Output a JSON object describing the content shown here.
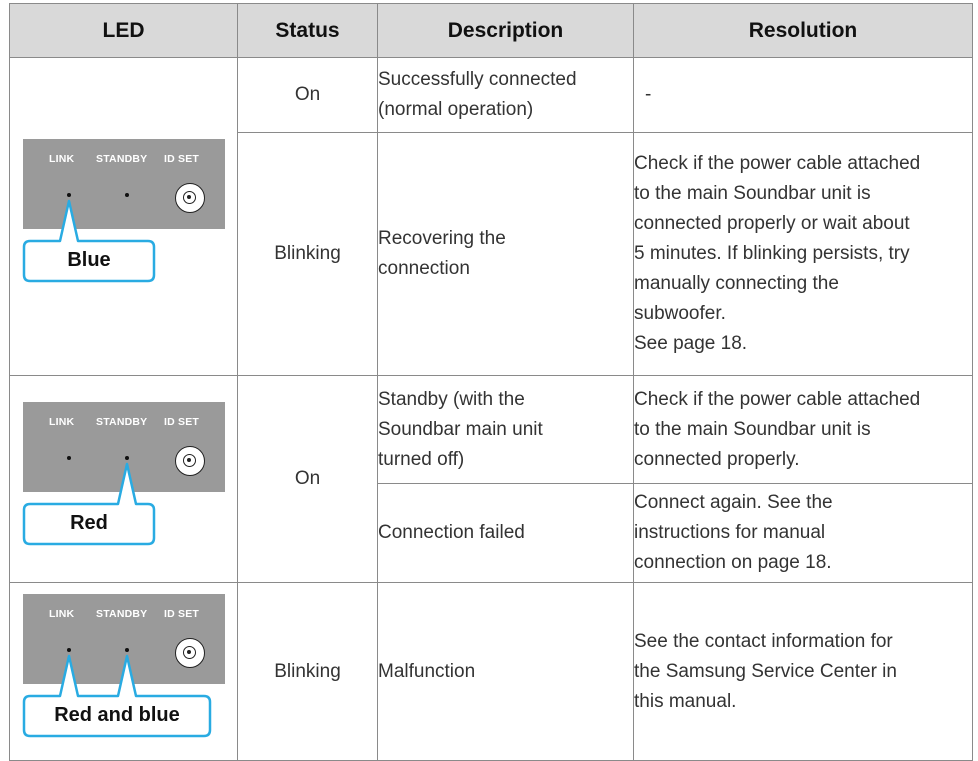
{
  "headers": {
    "led": "LED",
    "status": "Status",
    "description": "Description",
    "resolution": "Resolution"
  },
  "led_panels": {
    "link_label": "LINK",
    "standby_label": "STANDBY",
    "idset_label": "ID SET"
  },
  "groups": [
    {
      "callout": "Blue",
      "lit": [
        "link"
      ]
    },
    {
      "callout": "Red",
      "lit": [
        "standby"
      ]
    },
    {
      "callout": "Red and blue",
      "lit": [
        "link",
        "standby"
      ]
    }
  ],
  "rows": {
    "r1": {
      "status": "On",
      "description": "Successfully connected\n(normal operation)",
      "resolution": "-"
    },
    "r2": {
      "status": "Blinking",
      "description": "Recovering the\nconnection",
      "resolution": "Check if the power cable attached\nto the main Soundbar unit is\nconnected properly or wait about\n5 minutes. If blinking persists, try\nmanually connecting the\nsubwoofer.\nSee page 18."
    },
    "r3": {
      "status": "On",
      "description": "Standby (with the\nSoundbar main unit\nturned off)",
      "resolution": "Check if the power cable attached\nto the main Soundbar unit is\nconnected properly."
    },
    "r4": {
      "description": "Connection failed",
      "resolution": "Connect again. See the\ninstructions for manual\nconnection on page 18."
    },
    "r5": {
      "status": "Blinking",
      "description": "Malfunction",
      "resolution": "See the contact information for\nthe Samsung Service Center in\nthis manual."
    }
  },
  "colors": {
    "header_bg": "#d9d9d9",
    "panel_bg": "#9a9a9a",
    "callout_border": "#29abe2",
    "border": "#8a8a8a"
  }
}
